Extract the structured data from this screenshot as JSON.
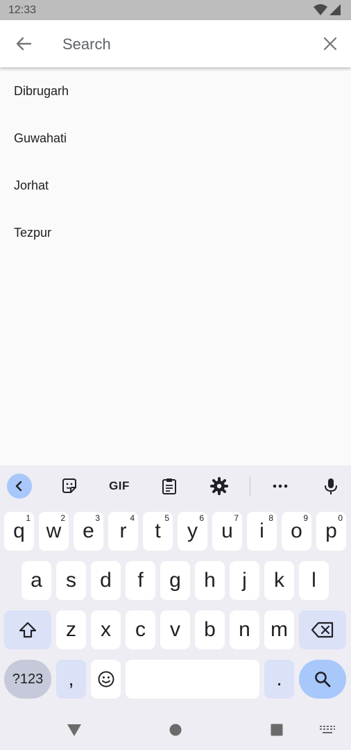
{
  "status_bar": {
    "time": "12:33"
  },
  "search": {
    "placeholder": "Search",
    "value": ""
  },
  "results": [
    "Dibrugarh",
    "Guwahati",
    "Jorhat",
    "Tezpur"
  ],
  "keyboard": {
    "toolbar": {
      "gif_label": "GIF"
    },
    "row1": [
      {
        "label": "q",
        "hint": "1"
      },
      {
        "label": "w",
        "hint": "2"
      },
      {
        "label": "e",
        "hint": "3"
      },
      {
        "label": "r",
        "hint": "4"
      },
      {
        "label": "t",
        "hint": "5"
      },
      {
        "label": "y",
        "hint": "6"
      },
      {
        "label": "u",
        "hint": "7"
      },
      {
        "label": "i",
        "hint": "8"
      },
      {
        "label": "o",
        "hint": "9"
      },
      {
        "label": "p",
        "hint": "0"
      }
    ],
    "row2": [
      "a",
      "s",
      "d",
      "f",
      "g",
      "h",
      "j",
      "k",
      "l"
    ],
    "row3": [
      "z",
      "x",
      "c",
      "v",
      "b",
      "n",
      "m"
    ],
    "row4": {
      "symbols": "?123",
      "comma": ",",
      "period": "."
    }
  },
  "colors": {
    "accent": "#a8c7fa",
    "modifier": "#dbe1f7",
    "keyboard_bg": "#eeedf3"
  }
}
